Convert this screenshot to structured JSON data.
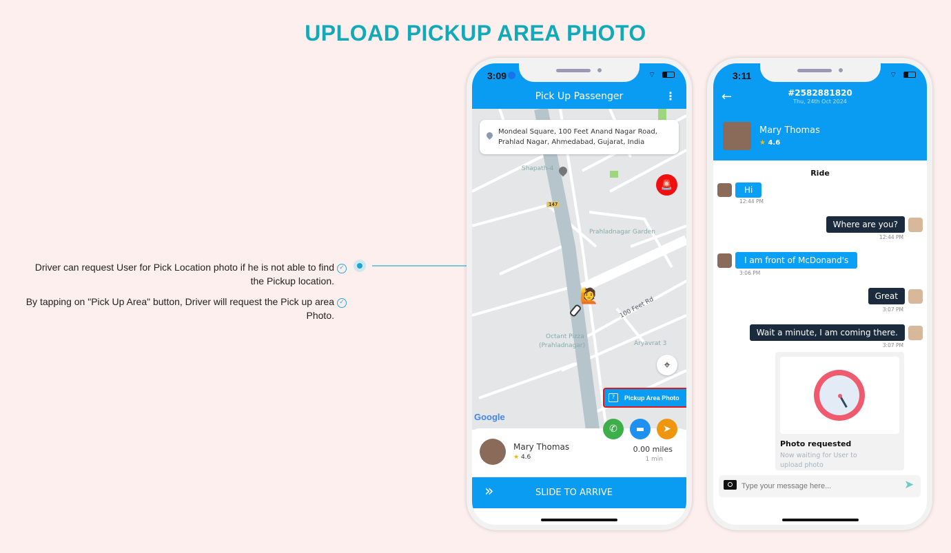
{
  "page": {
    "title": "UPLOAD PICKUP AREA PHOTO",
    "notes": [
      "Driver can request User for Pick Location photo if he is not able to find the Pickup location.",
      "By tapping on \"Pick Up Area\" button, Driver will request the Pick up area Photo."
    ]
  },
  "driver_screen": {
    "status_time": "3:09",
    "header_title": "Pick Up Passenger",
    "address": "Mondeal Square, 100 Feet Anand Nagar Road, Prahlad Nagar, Ahmedabad, Gujarat, India",
    "map_labels": {
      "shapath": "Shapath-4",
      "road_badge": "147",
      "garden": "Prahladnagar Garden",
      "road": "100 Feet Rd",
      "pizza1": "Octant Pizza",
      "pizza2": "(Prahladnagar)",
      "aryavrat": "Aryavrat 3",
      "google": "Google"
    },
    "pickup_area_button": "Pickup Area Photo",
    "passenger": {
      "name": "Mary Thomas",
      "rating": "4.6",
      "distance": "0.00 miles",
      "eta": "1 min"
    },
    "slide_label": "SLIDE TO ARRIVE"
  },
  "chat_screen": {
    "status_time": "3:11",
    "ride_id": "#2582881820",
    "date": "Thu, 24th Oct 2024",
    "user": {
      "name": "Mary Thomas",
      "rating": "4.6"
    },
    "section_label": "Ride",
    "messages": [
      {
        "from": "user",
        "text": "Hi",
        "time": "12:44 PM"
      },
      {
        "from": "driver",
        "text": "Where are you?",
        "time": "12:44 PM"
      },
      {
        "from": "user",
        "text": "I am front of McDonand's",
        "time": "3:06 PM"
      },
      {
        "from": "driver",
        "text": "Great",
        "time": "3:07 PM"
      },
      {
        "from": "driver",
        "text": "Wait a minute, I am coming there.",
        "time": "3:07 PM"
      }
    ],
    "photo_card": {
      "title": "Photo requested",
      "subtitle": "Now waiting for User to upload photo"
    },
    "input_placeholder": "Type your message here..."
  },
  "colors": {
    "accent": "#0a9bf3",
    "title": "#12a9b8",
    "driver_bubble": "#1b2a3c",
    "sos": "#f01010"
  }
}
